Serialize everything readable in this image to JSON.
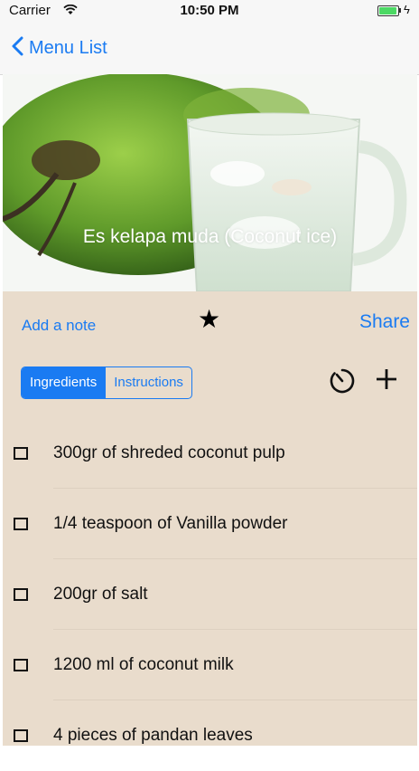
{
  "status_bar": {
    "carrier": "Carrier",
    "time": "10:50 PM"
  },
  "nav": {
    "back_label": "Menu List"
  },
  "hero": {
    "title": "Es kelapa muda (Coconut ice)"
  },
  "actions": {
    "add_note": "Add a note",
    "star": "★",
    "share": "Share"
  },
  "tabs": [
    {
      "label": "Ingredients",
      "selected": true
    },
    {
      "label": "Instructions",
      "selected": false
    }
  ],
  "ingredients": [
    "300gr of shreded coconut pulp",
    "1/4 teaspoon of Vanilla powder",
    "200gr of salt",
    "1200 ml of coconut milk",
    "4 pieces of pandan leaves"
  ],
  "colors": {
    "accent": "#1a7bf2",
    "content_bg": "#e9dccc",
    "battery": "#4cd964"
  },
  "icons": [
    "wifi-icon",
    "battery-icon",
    "back-chevron-icon",
    "star-icon",
    "timer-icon",
    "plus-icon",
    "checkbox-icon"
  ]
}
